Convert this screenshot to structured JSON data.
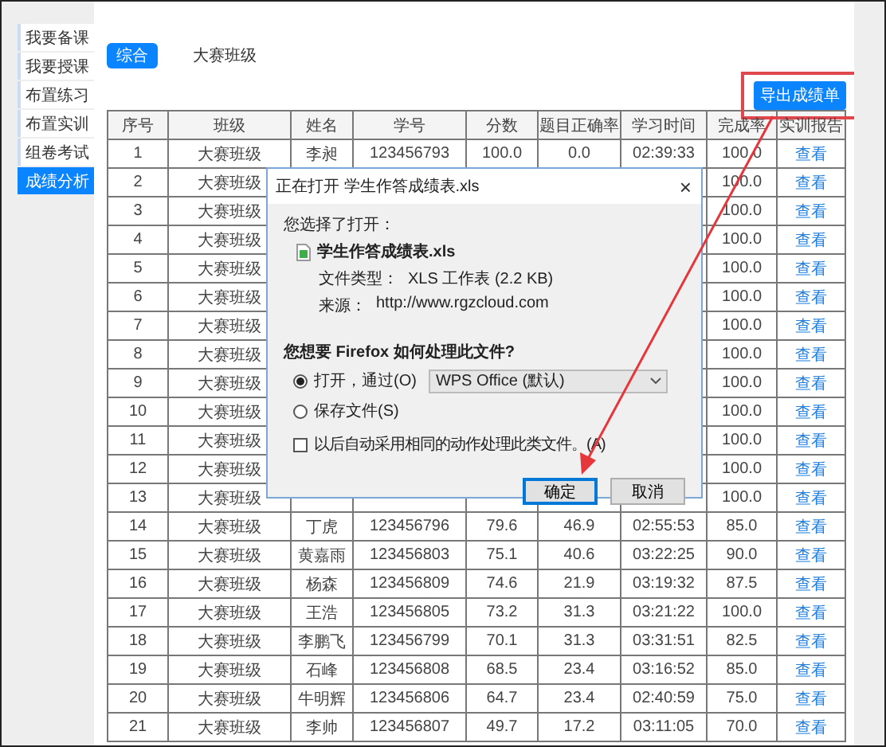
{
  "sidebar": {
    "items": [
      {
        "label": "我要备课",
        "selected": false
      },
      {
        "label": "我要授课",
        "selected": false
      },
      {
        "label": "布置练习",
        "selected": false
      },
      {
        "label": "布置实训",
        "selected": false
      },
      {
        "label": "组卷考试",
        "selected": false
      },
      {
        "label": "成绩分析",
        "selected": true
      }
    ]
  },
  "tabs": [
    {
      "label": "综合",
      "selected": true
    },
    {
      "label": "大赛班级",
      "selected": false
    }
  ],
  "export_button": "导出成绩单",
  "table": {
    "columns": [
      "序号",
      "班级",
      "姓名",
      "学号",
      "分数",
      "题目正确率",
      "学习时间",
      "完成率",
      "实训报告"
    ],
    "rows": [
      {
        "no": "1",
        "class": "大赛班级",
        "name": "李昶",
        "student_id": "123456793",
        "score": "100.0",
        "accuracy": "0.0",
        "study_time": "02:39:33",
        "completion": "100.0",
        "report": "查看"
      },
      {
        "no": "2",
        "class": "大赛班级",
        "completion": "100.0",
        "report": "查看"
      },
      {
        "no": "3",
        "class": "大赛班级",
        "completion": "100.0",
        "report": "查看"
      },
      {
        "no": "4",
        "class": "大赛班级",
        "completion": "100.0",
        "report": "查看"
      },
      {
        "no": "5",
        "class": "大赛班级",
        "completion": "100.0",
        "report": "查看"
      },
      {
        "no": "6",
        "class": "大赛班级",
        "completion": "100.0",
        "report": "查看"
      },
      {
        "no": "7",
        "class": "大赛班级",
        "completion": "100.0",
        "report": "查看"
      },
      {
        "no": "8",
        "class": "大赛班级",
        "completion": "100.0",
        "report": "查看"
      },
      {
        "no": "9",
        "class": "大赛班级",
        "completion": "100.0",
        "report": "查看"
      },
      {
        "no": "10",
        "class": "大赛班级",
        "completion": "100.0",
        "report": "查看"
      },
      {
        "no": "11",
        "class": "大赛班级",
        "completion": "100.0",
        "report": "查看"
      },
      {
        "no": "12",
        "class": "大赛班级",
        "completion": "100.0",
        "report": "查看"
      },
      {
        "no": "13",
        "class": "大赛班级",
        "completion": "100.0",
        "report": "查看"
      },
      {
        "no": "14",
        "class": "大赛班级",
        "name": "丁虎",
        "student_id": "123456796",
        "score": "79.6",
        "accuracy": "46.9",
        "study_time": "02:55:53",
        "completion": "85.0",
        "report": "查看"
      },
      {
        "no": "15",
        "class": "大赛班级",
        "name": "黄嘉雨",
        "student_id": "123456803",
        "score": "75.1",
        "accuracy": "40.6",
        "study_time": "03:22:25",
        "completion": "90.0",
        "report": "查看"
      },
      {
        "no": "16",
        "class": "大赛班级",
        "name": "杨森",
        "student_id": "123456809",
        "score": "74.6",
        "accuracy": "21.9",
        "study_time": "03:19:32",
        "completion": "87.5",
        "report": "查看"
      },
      {
        "no": "17",
        "class": "大赛班级",
        "name": "王浩",
        "student_id": "123456805",
        "score": "73.2",
        "accuracy": "31.3",
        "study_time": "03:21:22",
        "completion": "100.0",
        "report": "查看"
      },
      {
        "no": "18",
        "class": "大赛班级",
        "name": "李鹏飞",
        "student_id": "123456799",
        "score": "70.1",
        "accuracy": "31.3",
        "study_time": "03:31:51",
        "completion": "82.5",
        "report": "查看"
      },
      {
        "no": "19",
        "class": "大赛班级",
        "name": "石峰",
        "student_id": "123456808",
        "score": "68.5",
        "accuracy": "23.4",
        "study_time": "03:16:52",
        "completion": "85.0",
        "report": "查看"
      },
      {
        "no": "20",
        "class": "大赛班级",
        "name": "牛明辉",
        "student_id": "123456806",
        "score": "64.7",
        "accuracy": "23.4",
        "study_time": "02:40:59",
        "completion": "75.0",
        "report": "查看"
      },
      {
        "no": "21",
        "class": "大赛班级",
        "name": "李帅",
        "student_id": "123456807",
        "score": "49.7",
        "accuracy": "17.2",
        "study_time": "03:11:05",
        "completion": "70.0",
        "report": "查看"
      }
    ]
  },
  "dialog": {
    "title": "正在打开 学生作答成绩表.xls",
    "close": "×",
    "intro": "您选择了打开：",
    "file_name": "学生作答成绩表.xls",
    "details": [
      {
        "label": "文件类型：",
        "value": "XLS 工作表 (2.2 KB)"
      },
      {
        "label": "来源：",
        "value": "http://www.rgzcloud.com"
      }
    ],
    "question": "您想要 Firefox 如何处理此文件?",
    "options": [
      {
        "label": "打开，通过(O)",
        "selected": true,
        "app": "WPS Office (默认)"
      },
      {
        "label": "保存文件(S)",
        "selected": false
      }
    ],
    "remember": {
      "label": "以后自动采用相同的动作处理此类文件。(A)",
      "checked": false
    },
    "buttons": [
      {
        "label": "确定",
        "default": true
      },
      {
        "label": "取消",
        "default": false
      }
    ]
  }
}
